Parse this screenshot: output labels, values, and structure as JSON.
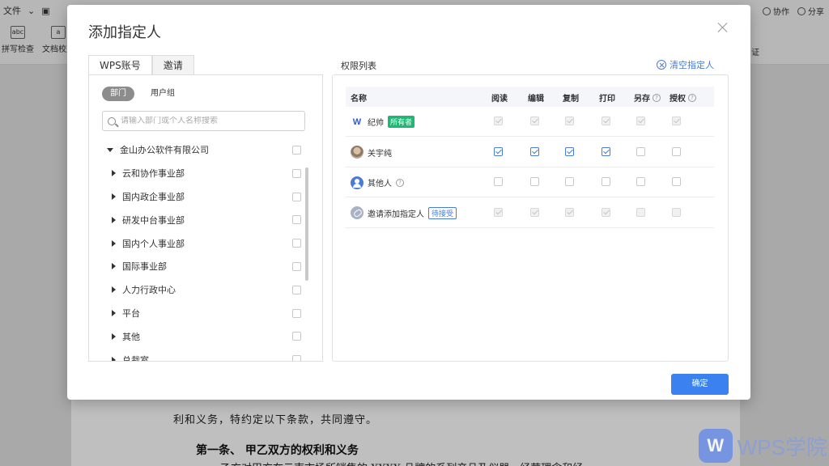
{
  "app": {
    "menu_file": "文件",
    "tool_spell": "拼写检查",
    "tool_spell_icon_text": "abc",
    "tool_proof": "文档校对",
    "tool_proof_icon_text": "a",
    "collab": "协作",
    "share": "分享",
    "cert": "证"
  },
  "document": {
    "line1": "利和义务，特约定以下条款，共同遵守。",
    "line2": "第一条、    甲乙双方的权利和义务",
    "line3": "乙方对甲方在云南市场所销售的 XXXX 品牌的系列产品及仪器，经营理念和经"
  },
  "watermark": {
    "logo": "W",
    "text": "WPS学院"
  },
  "dialog": {
    "title": "添加指定人",
    "close_icon": "close-icon",
    "tabs": [
      "WPS账号",
      "邀请"
    ],
    "segments": [
      "部门",
      "用户组"
    ],
    "search_placeholder": "请输入部门或个人名称搜索",
    "tree": [
      {
        "label": "金山办公软件有限公司",
        "expanded": true,
        "level": 0
      },
      {
        "label": "云和协作事业部",
        "expanded": false,
        "level": 1
      },
      {
        "label": "国内政企事业部",
        "expanded": false,
        "level": 1
      },
      {
        "label": "研发中台事业部",
        "expanded": false,
        "level": 1
      },
      {
        "label": "国内个人事业部",
        "expanded": false,
        "level": 1
      },
      {
        "label": "国际事业部",
        "expanded": false,
        "level": 1
      },
      {
        "label": "人力行政中心",
        "expanded": false,
        "level": 1
      },
      {
        "label": "平台",
        "expanded": false,
        "level": 1
      },
      {
        "label": "其他",
        "expanded": false,
        "level": 1
      },
      {
        "label": "总裁室",
        "expanded": false,
        "level": 1
      }
    ],
    "perm_title": "权限列表",
    "clear_label": "清空指定人",
    "columns": [
      "名称",
      "阅读",
      "编辑",
      "复制",
      "打印",
      "另存",
      "授权"
    ],
    "columns_with_help": [
      "另存",
      "授权"
    ],
    "rows": [
      {
        "name": "纪帅",
        "avatar": "wps-logo",
        "avatar_text": "W",
        "badge": "所有者",
        "badge_type": "owner",
        "perms": [
          true,
          true,
          true,
          true,
          true,
          true
        ],
        "disabled": true
      },
      {
        "name": "关宇纯",
        "avatar": "photo",
        "avatar_text": "",
        "badge": "",
        "badge_type": "",
        "perms": [
          true,
          true,
          true,
          true,
          false,
          false
        ],
        "disabled": false
      },
      {
        "name": "其他人",
        "avatar": "user",
        "avatar_text": "",
        "badge": "?",
        "badge_type": "help",
        "perms": [
          false,
          false,
          false,
          false,
          false,
          false
        ],
        "disabled": false
      },
      {
        "name": "邀请添加指定人",
        "avatar": "link",
        "avatar_text": "",
        "badge": "待接受",
        "badge_type": "pending",
        "perms": [
          true,
          true,
          true,
          true,
          false,
          false
        ],
        "disabled": true
      }
    ],
    "confirm_label": "确定",
    "accent_color": "#3b82f0",
    "owner_badge_color": "#22b573"
  }
}
